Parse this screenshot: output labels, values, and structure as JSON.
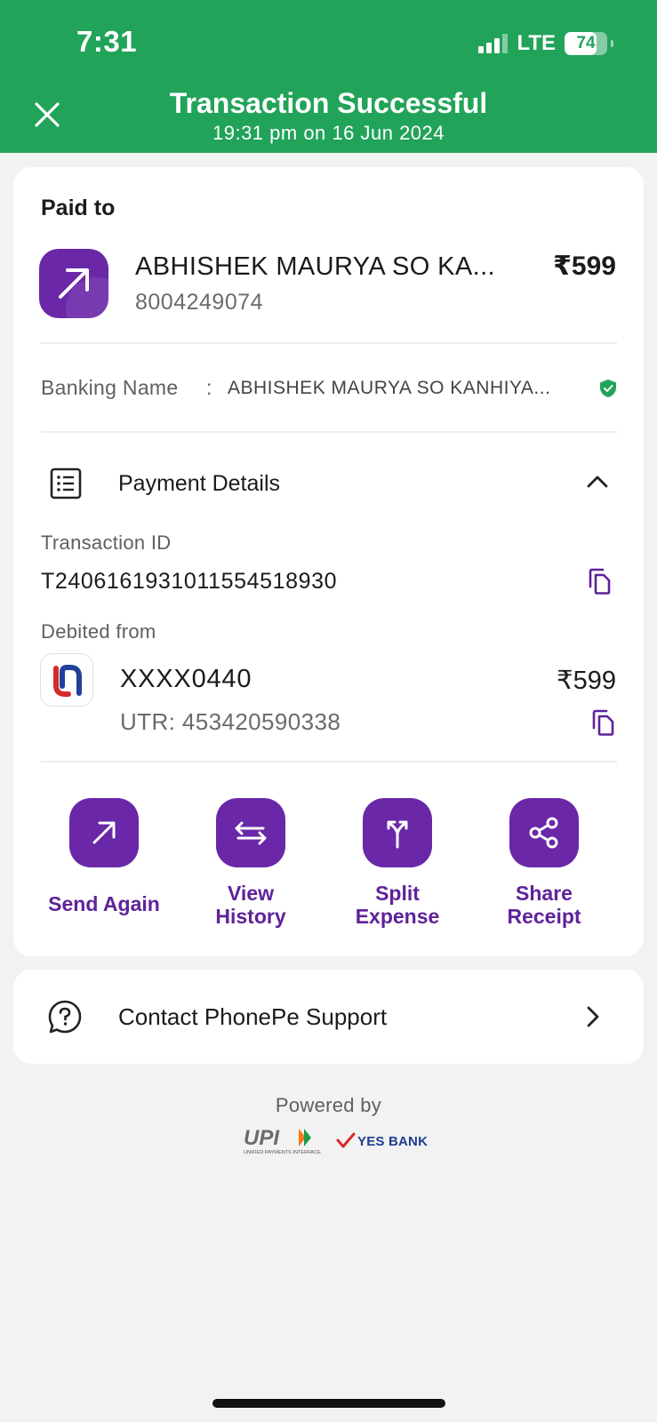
{
  "status_bar": {
    "time": "7:31",
    "network": "LTE",
    "battery": "74",
    "battery_level": 0.74
  },
  "header": {
    "title": "Transaction Successful",
    "subtitle": "19:31 pm on 16 Jun 2024",
    "background": "#22a35a"
  },
  "paid_to": {
    "label": "Paid to",
    "name": "ABHISHEK MAURYA SO KA...",
    "phone": "8004249074",
    "amount": "₹599"
  },
  "banking": {
    "label": "Banking Name",
    "colon": ":",
    "name": "ABHISHEK MAURYA SO KANHIYA..."
  },
  "payment_details": {
    "title": "Payment Details",
    "transaction_id_label": "Transaction ID",
    "transaction_id": "T2406161931011554518930",
    "debited_from_label": "Debited from",
    "account": "XXXX0440",
    "amount": "₹599",
    "utr": "UTR: 453420590338"
  },
  "actions": [
    {
      "line1": "Send Again",
      "line2": ""
    },
    {
      "line1": "View",
      "line2": "History"
    },
    {
      "line1": "Split",
      "line2": "Expense"
    },
    {
      "line1": "Share",
      "line2": "Receipt"
    }
  ],
  "support": {
    "label": "Contact PhonePe Support"
  },
  "footer": {
    "powered_by": "Powered by",
    "upi_mark": "UPI",
    "upi_tagline": "UNIFIED PAYMENTS INTERFACE",
    "bank": "YES BANK"
  },
  "colors": {
    "accent": "#6a27a8",
    "success": "#22a35a",
    "background": "#f2f2f2"
  }
}
